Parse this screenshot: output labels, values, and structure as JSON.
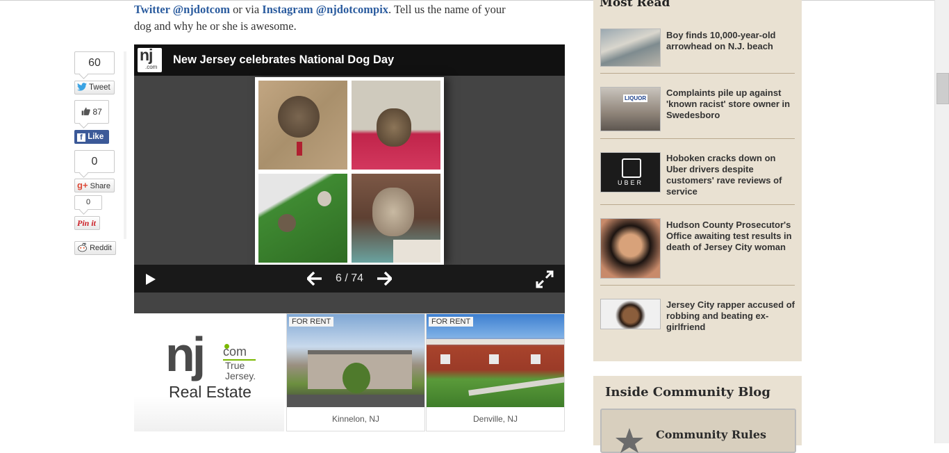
{
  "article": {
    "intro_link1": "Twitter @njdotcom",
    "intro_mid": " or via ",
    "intro_link2": "Instagram @njdotcompix",
    "intro_rest1": ". Tell us the name of your",
    "intro_rest2": "dog and why he or she is awesome."
  },
  "share": {
    "twitter_count": "60",
    "twitter_label": "Tweet",
    "facebook_count": "87",
    "facebook_label": "Like",
    "gplus_count": "0",
    "gplus_label": "Share",
    "pinterest_count": "0",
    "pinterest_label": "Pin it",
    "reddit_label": "Reddit"
  },
  "gallery": {
    "logo_text": "nj",
    "logo_sub": ".com",
    "title": "New Jersey celebrates National Dog Day",
    "counter": "6 / 74"
  },
  "real_estate": {
    "logo_com": "com",
    "logo_tagline1": "True",
    "logo_tagline2": "Jersey.",
    "logo_label": "Real Estate",
    "listings": [
      {
        "tag": "FOR RENT",
        "location": "Kinnelon, NJ"
      },
      {
        "tag": "FOR RENT",
        "location": "Denville, NJ"
      }
    ]
  },
  "sidebar": {
    "title": "Most Read",
    "items": [
      {
        "headline": "Boy finds 10,000-year-old arrowhead on N.J. beach"
      },
      {
        "headline": "Complaints pile up against 'known racist' store owner in Swedesboro",
        "thumb_sign": "LIQUOR"
      },
      {
        "headline": "Hoboken cracks down on Uber drivers despite customers' rave reviews of service",
        "thumb_text": "UBER"
      },
      {
        "headline": "Hudson County Prosecutor's Office awaiting test results in death of Jersey City woman"
      },
      {
        "headline": "Jersey City rapper accused of robbing and beating ex-girlfriend"
      }
    ],
    "blog_title": "Inside Community Blog",
    "blog_rules": "Community Rules"
  },
  "colors": {
    "link": "#2a5b9e",
    "sidebar_bg": "#e9e1d2",
    "gallery_bg": "#444444",
    "facebook": "#3b5998"
  }
}
